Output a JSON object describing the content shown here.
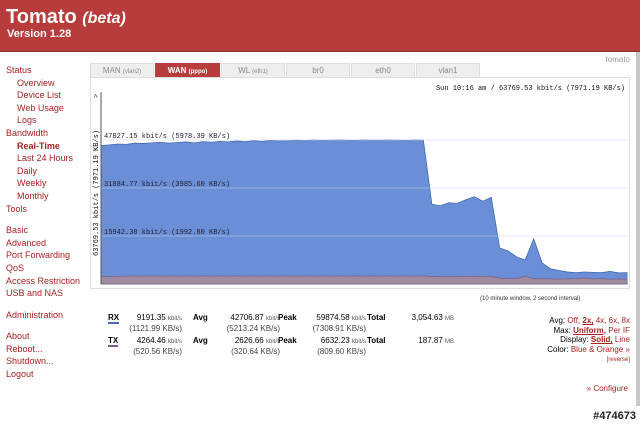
{
  "header": {
    "title": "Tomato",
    "title_suffix": "(beta)",
    "version": "Version 1.28",
    "brand_small": "tomato"
  },
  "sidebar": {
    "items": [
      {
        "label": "Status",
        "level": 0,
        "active": false
      },
      {
        "label": "Overview",
        "level": 1,
        "active": false
      },
      {
        "label": "Device List",
        "level": 1,
        "active": false
      },
      {
        "label": "Web Usage",
        "level": 1,
        "active": false
      },
      {
        "label": "Logs",
        "level": 1,
        "active": false
      },
      {
        "label": "Bandwidth",
        "level": 0,
        "active": false
      },
      {
        "label": "Real-Time",
        "level": 1,
        "active": true
      },
      {
        "label": "Last 24 Hours",
        "level": 1,
        "active": false
      },
      {
        "label": "Daily",
        "level": 1,
        "active": false
      },
      {
        "label": "Weekly",
        "level": 1,
        "active": false
      },
      {
        "label": "Monthly",
        "level": 1,
        "active": false
      },
      {
        "label": "Tools",
        "level": 0,
        "active": false
      },
      {
        "gap": true
      },
      {
        "label": "Basic",
        "level": 0,
        "active": false
      },
      {
        "label": "Advanced",
        "level": 0,
        "active": false
      },
      {
        "label": "Port Forwarding",
        "level": 0,
        "active": false
      },
      {
        "label": "QoS",
        "level": 0,
        "active": false
      },
      {
        "label": "Access Restriction",
        "level": 0,
        "active": false
      },
      {
        "label": "USB and NAS",
        "level": 0,
        "active": false
      },
      {
        "gap": true
      },
      {
        "label": "Administration",
        "level": 0,
        "active": false
      },
      {
        "gap": true
      },
      {
        "label": "About",
        "level": 0,
        "active": false
      },
      {
        "label": "Reboot...",
        "level": 0,
        "active": false
      },
      {
        "label": "Shutdown...",
        "level": 0,
        "active": false
      },
      {
        "label": "Logout",
        "level": 0,
        "active": false
      }
    ]
  },
  "tabs": [
    {
      "label": "MAN",
      "sub": "(vlan2)",
      "active": false
    },
    {
      "label": "WAN",
      "sub": "(pppo)",
      "active": true
    },
    {
      "label": "WL",
      "sub": "(eth1)",
      "active": false
    },
    {
      "label": "br0",
      "sub": "",
      "active": false
    },
    {
      "label": "eth0",
      "sub": "",
      "active": false
    },
    {
      "label": "vlan1",
      "sub": "",
      "active": false
    }
  ],
  "graph": {
    "header_text": "Sun 10:16 am / 63769.53 kbit/s (7971.19 KB/s)",
    "yaxis_label": "63769.53 kbit/s (7971.19 KB/s)",
    "gridlines": [
      {
        "label": "47827.15 kbit/s (5978.39 KB/s)",
        "value": 47827.15
      },
      {
        "label": "31884.77 kbit/s (3985.60 KB/s)",
        "value": 31884.77
      },
      {
        "label": "15942.38 kbit/s (1992.80 KB/s)",
        "value": 15942.38
      }
    ],
    "max_kbit": 63769.53,
    "window_note": "(10 minute window, 2 second interval)",
    "rx_color": "#6b8fd6",
    "tx_color": "#a08aa2",
    "arrow_glyph": ">"
  },
  "chart_data": {
    "type": "area",
    "ylim": [
      0,
      63769.53
    ],
    "series": [
      {
        "name": "RX",
        "values": [
          46000,
          46200,
          46500,
          46400,
          46800,
          46700,
          46900,
          47100,
          46800,
          47000,
          47200,
          46900,
          47300,
          47100,
          47400,
          47200,
          47500,
          47300,
          47600,
          47400,
          47700,
          47500,
          47600,
          47800,
          47600,
          47900,
          47700,
          47800,
          47900,
          47800,
          47700,
          47900,
          47800,
          47800,
          47900,
          47800,
          47700,
          47900,
          47800,
          26500,
          26000,
          27000,
          26800,
          28000,
          29000,
          27500,
          28800,
          12000,
          11000,
          9000,
          8000,
          15000,
          7000,
          5000,
          4500,
          4000,
          3800,
          4000,
          3900,
          3800,
          4200,
          3700,
          3800
        ]
      },
      {
        "name": "TX",
        "values": [
          2400,
          2500,
          2600,
          2600,
          2700,
          2600,
          2700,
          2600,
          2700,
          2600,
          2700,
          2600,
          2700,
          2600,
          2700,
          2600,
          2700,
          2600,
          2700,
          2600,
          2700,
          2600,
          2700,
          2600,
          2700,
          2600,
          2700,
          2600,
          2700,
          2600,
          2700,
          2600,
          2700,
          2600,
          2700,
          2600,
          2700,
          2600,
          2700,
          2500,
          2500,
          2400,
          2500,
          2600,
          2500,
          2600,
          2500,
          2000,
          1800,
          1800,
          2600,
          1700,
          1800,
          1700,
          1600,
          1700,
          1800,
          2000,
          1700,
          1800,
          1600,
          1700,
          1600
        ]
      }
    ]
  },
  "stats": {
    "rx": {
      "label": "RX",
      "cur": "9191.35",
      "cur_unit": "kbit/s",
      "cur_sub": "(1121.99 KB/s)",
      "avg_label": "Avg",
      "avg": "42706.87",
      "avg_unit": "kbit/s",
      "avg_sub": "(5213.24 KB/s)",
      "peak_label": "Peak",
      "peak": "59874.58",
      "peak_unit": "kbit/s",
      "peak_sub": "(7308.91 KB/s)",
      "total_label": "Total",
      "total": "3,054.63",
      "total_unit": "MB"
    },
    "tx": {
      "label": "TX",
      "cur": "4264.46",
      "cur_unit": "kbit/s",
      "cur_sub": "(520.56 KB/s)",
      "avg_label": "Avg",
      "avg": "2626.66",
      "avg_unit": "kbit/s",
      "avg_sub": "(320.64 KB/s)",
      "peak_label": "Peak",
      "peak": "6632.23",
      "peak_unit": "kbit/s",
      "peak_sub": "(809.60 KB/s)",
      "total_label": "Total",
      "total": "187.87",
      "total_unit": "MB"
    }
  },
  "options": {
    "avg_label": "Avg:",
    "avg_opts": [
      "Off,",
      "2x,",
      "4x,",
      "6x,",
      "8x"
    ],
    "avg_selected": 1,
    "max_label": "Max:",
    "max_opts": [
      "Uniform,",
      "Per IF"
    ],
    "max_selected": 0,
    "display_label": "Display:",
    "display_opts": [
      "Solid,",
      "Line"
    ],
    "display_selected": 0,
    "color_label": "Color:",
    "color_value": "Blue & Orange »",
    "reverse": "[reverse]"
  },
  "configure": "» Configure",
  "watermark": "#474673"
}
